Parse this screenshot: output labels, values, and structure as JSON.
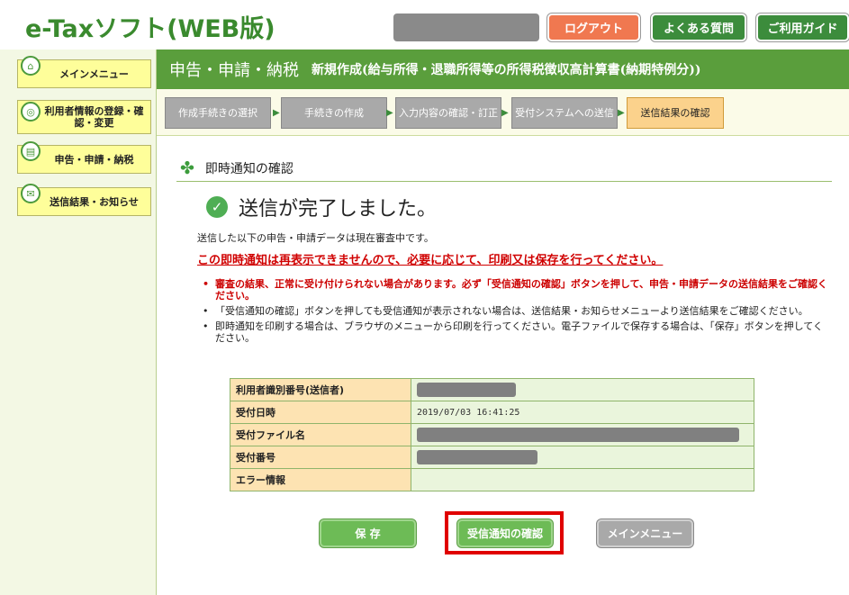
{
  "header": {
    "logo": "e-Taxソフト(WEB版)",
    "logout_label": "ログアウト",
    "faq_label": "よくある質問",
    "guide_label": "ご利用ガイド"
  },
  "sidebar": {
    "items": [
      {
        "label": "メインメニュー",
        "icon": "home-icon"
      },
      {
        "label": "利用者情報の登録・確認・変更",
        "icon": "user-icon"
      },
      {
        "label": "申告・申請・納税",
        "icon": "document-icon"
      },
      {
        "label": "送信結果・お知らせ",
        "icon": "mail-icon"
      }
    ]
  },
  "title": {
    "main": "申告・申請・納税",
    "sub": "新規作成(給与所得・退職所得等の所得税徴収高計算書(納期特例分))"
  },
  "steps": [
    {
      "label": "作成手続きの選択"
    },
    {
      "label": "手続きの作成"
    },
    {
      "label": "入力内容の確認・訂正"
    },
    {
      "label": "受付システムへの送信"
    },
    {
      "label": "送信結果の確認",
      "active": true
    }
  ],
  "section": {
    "title": "即時通知の確認",
    "done_text": "送信が完了しました。",
    "p1": "送信した以下の申告・申請データは現在審査中です。",
    "warning": "この即時通知は再表示できませんので、必要に応じて、印刷又は保存を行ってください。",
    "notes": [
      {
        "text": "審査の結果、正常に受け付けられない場合があります。必ず「受信通知の確認」ボタンを押して、申告・申請データの送信結果をご確認ください。",
        "red": true
      },
      {
        "text": "「受信通知の確認」ボタンを押しても受信通知が表示されない場合は、送信結果・お知らせメニューより送信結果をご確認ください。"
      },
      {
        "text": "即時通知を印刷する場合は、ブラウザのメニューから印刷を行ってください。電子ファイルで保存する場合は、「保存」ボタンを押してください。"
      }
    ]
  },
  "table": {
    "rows": [
      {
        "key": "利用者識別番号(送信者)",
        "value": "",
        "masked": true
      },
      {
        "key": "受付日時",
        "value": "2019/07/03 16:41:25"
      },
      {
        "key": "受付ファイル名",
        "value": "",
        "masked": true
      },
      {
        "key": "受付番号",
        "value": "",
        "masked": true
      },
      {
        "key": "エラー情報",
        "value": ""
      }
    ]
  },
  "buttons": {
    "save": "保 存",
    "confirm": "受信通知の確認",
    "mainmenu": "メインメニュー"
  }
}
